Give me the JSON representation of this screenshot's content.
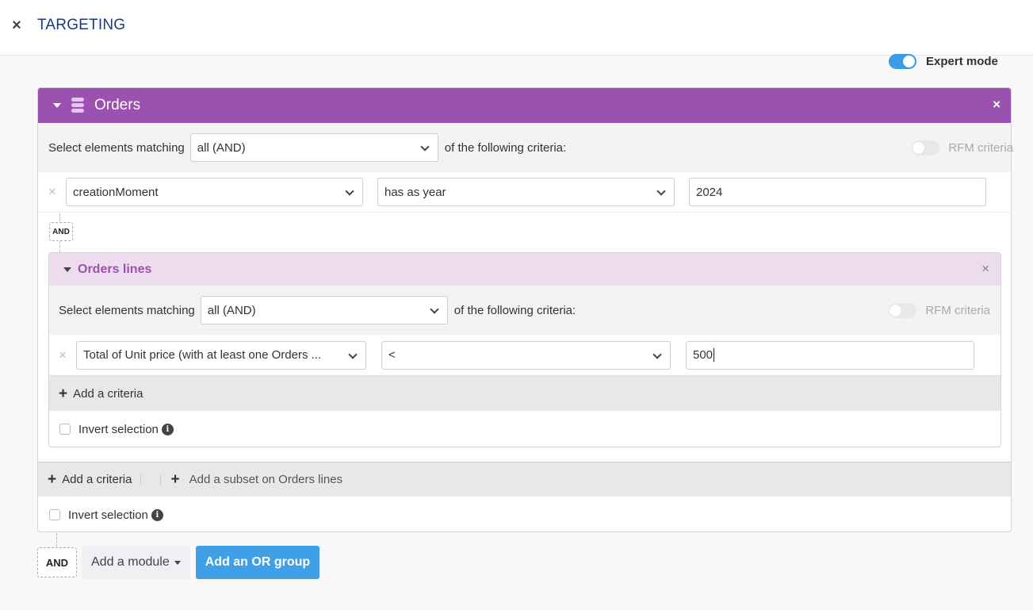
{
  "header": {
    "title": "TARGETING",
    "close_icon": "close-icon"
  },
  "expert_mode": {
    "label": "Expert mode",
    "enabled": true,
    "accent": "#3b9ce5"
  },
  "module": {
    "name": "Orders",
    "icon": "database-icon",
    "color": "#9a51b0",
    "match_label": "Select elements matching",
    "match_value": "all (AND)",
    "match_suffix": "of the following criteria:",
    "rfm_label": "RFM criteria",
    "rfm_enabled": false,
    "criteria": [
      {
        "field": "creationMoment",
        "operator": "has as year",
        "value": "2024"
      }
    ],
    "connector": "AND",
    "subset": {
      "name": "Orders lines",
      "match_label": "Select elements matching",
      "match_value": "all (AND)",
      "match_suffix": "of the following criteria:",
      "rfm_label": "RFM criteria",
      "rfm_enabled": false,
      "criteria": [
        {
          "field": "Total of Unit price (with at least one Orders ...",
          "operator": "<",
          "value": "500"
        }
      ],
      "add_criteria_label": "Add a criteria",
      "invert_label": "Invert selection",
      "invert_checked": false
    },
    "add_criteria_label": "Add a criteria",
    "add_subset_label": "Add a subset on Orders lines",
    "invert_label": "Invert selection",
    "invert_checked": false
  },
  "footer": {
    "connector": "AND",
    "add_module_label": "Add a module",
    "add_or_group_label": "Add an OR group",
    "or_button_color": "#3fa0e8"
  }
}
